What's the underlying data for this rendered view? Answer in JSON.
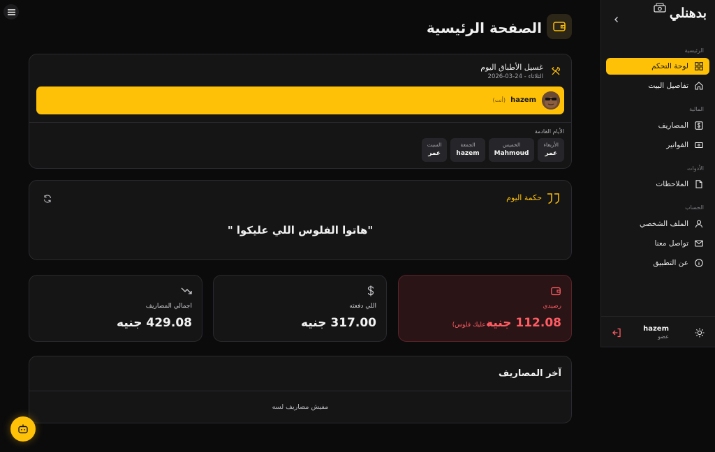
{
  "app": {
    "brand": "بدهنلي"
  },
  "sidebar": {
    "sections": [
      {
        "title": "الرئيسية",
        "items": [
          {
            "label": "لوحة التحكم",
            "icon": "dashboard-icon",
            "active": true
          },
          {
            "label": "تفاصيل البيت",
            "icon": "home-icon",
            "active": false
          }
        ]
      },
      {
        "title": "المالية",
        "items": [
          {
            "label": "المصاريف",
            "icon": "dollar-icon",
            "active": false
          },
          {
            "label": "الفواتير",
            "icon": "bill-icon",
            "active": false
          }
        ]
      },
      {
        "title": "الأدوات",
        "items": [
          {
            "label": "الملاحظات",
            "icon": "note-icon",
            "active": false
          }
        ]
      },
      {
        "title": "الحساب",
        "items": [
          {
            "label": "الملف الشخصي",
            "icon": "user-icon",
            "active": false
          },
          {
            "label": "تواصل معنا",
            "icon": "mail-icon",
            "active": false
          },
          {
            "label": "عن التطبيق",
            "icon": "info-icon",
            "active": false
          }
        ]
      }
    ],
    "user": {
      "name": "hazem",
      "role": "عضو"
    }
  },
  "header": {
    "title": "الصفحة الرئيسية"
  },
  "chore": {
    "title": "غسيل الأطباق اليوم",
    "date": "الثلاثاء - 24-03-2026",
    "assignee": {
      "name": "hazem",
      "role": "(أنت)"
    },
    "upcoming_label": "الأيام القادمة",
    "upcoming": [
      {
        "day": "الأربعاء",
        "person": "عمر"
      },
      {
        "day": "الخميس",
        "person": "Mahmoud"
      },
      {
        "day": "الجمعة",
        "person": "hazem"
      },
      {
        "day": "السبت",
        "person": "عمر"
      }
    ]
  },
  "quote": {
    "title": "حكمة اليوم",
    "text": "\"هاتوا الفلوس اللي عليكوا \""
  },
  "stats": {
    "balance": {
      "label": "رصيدي",
      "value": "112.08 جنيه",
      "note": "( عليك فلوس)"
    },
    "paid": {
      "label": "اللي دفعته",
      "value": "317.00 جنيه"
    },
    "total": {
      "label": "اجمالي المصاريف",
      "value": "429.08 جنيه"
    }
  },
  "latest": {
    "title": "آخر المصاريف",
    "empty": "مفيش مصاريف لسه"
  },
  "colors": {
    "accent": "#ffc107",
    "danger": "#ff5c63",
    "bg": "#0b0b0c",
    "card": "#151516"
  }
}
